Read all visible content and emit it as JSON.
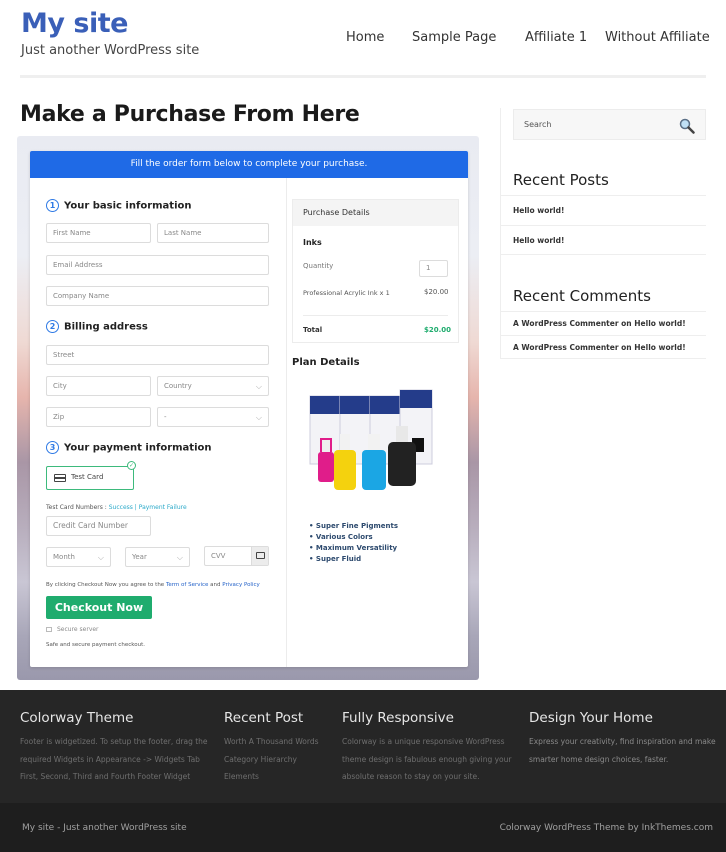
{
  "header": {
    "site_title": "My site",
    "tagline": "Just another WordPress site",
    "nav": [
      "Home",
      "Sample Page",
      "Affiliate 1",
      "Without Affiliate"
    ]
  },
  "page": {
    "title": "Make a Purchase From Here"
  },
  "form": {
    "banner": "Fill the order form below to complete your purchase.",
    "step1": {
      "num": "1",
      "title": "Your basic information"
    },
    "step2": {
      "num": "2",
      "title": "Billing address"
    },
    "step3": {
      "num": "3",
      "title": "Your payment information"
    },
    "placeholders": {
      "first_name": "First Name",
      "last_name": "Last Name",
      "email": "Email Address",
      "company": "Company Name",
      "street": "Street",
      "city": "City",
      "country": "Country",
      "zip": "Zip",
      "state": "-",
      "card_number": "Credit Card Number",
      "month": "Month",
      "year": "Year",
      "cvv": "CVV"
    },
    "payment_method": "Test Card",
    "test_numbers_label": "Test Card Numbers : ",
    "test_success": "Success",
    "test_sep": " | ",
    "test_failure": "Payment Failure",
    "agree_prefix": "By clicking Checkout Now you agree to the ",
    "terms": "Term of Service",
    "and": " and ",
    "privacy": "Privacy Policy",
    "checkout_label": "Checkout Now",
    "secure_label": "Secure server",
    "safe_label": "Safe and secure payment checkout."
  },
  "purchase": {
    "header": "Purchase Details",
    "product_group": "Inks",
    "quantity_label": "Quantity",
    "quantity_value": "1",
    "item_name": "Professional Acrylic Ink x 1",
    "item_price": "$20.00",
    "total_label": "Total",
    "total_value": "$20.00",
    "total_color": "#1fac6e"
  },
  "plan": {
    "title": "Plan Details",
    "image_alt": "ink bottles product image",
    "features": [
      "Super Fine Pigments",
      "Various Colors",
      "Maximum Versatility",
      "Super Fluid"
    ]
  },
  "sidebar": {
    "search_placeholder": "Search",
    "recent_posts_title": "Recent Posts",
    "recent_posts": [
      "Hello world!",
      "Hello world!"
    ],
    "recent_comments_title": "Recent Comments",
    "recent_comments": [
      "A WordPress Commenter on Hello world!",
      "A WordPress Commenter on Hello world!"
    ]
  },
  "footer": {
    "cols": [
      {
        "title": "Colorway Theme",
        "lines": [
          "Footer is widgetized. To setup the footer, drag the",
          "required Widgets in Appearance -> Widgets Tab",
          "First, Second, Third and Fourth Footer Widget"
        ]
      },
      {
        "title": "Recent Post",
        "lines": [
          "Worth A Thousand Words",
          "Category Hierarchy",
          "Elements"
        ]
      },
      {
        "title": "Fully Responsive",
        "lines": [
          "Colorway is a unique responsive WordPress",
          "theme design is fabulous enough giving your",
          "absolute reason to stay on your site."
        ]
      },
      {
        "title": "Design Your Home",
        "lines": [
          "Express your creativity, find inspiration and make",
          "smarter home design choices, faster."
        ]
      }
    ],
    "bottom_left": "My site - Just another WordPress site",
    "bottom_right": "Colorway WordPress Theme by InkThemes.com"
  },
  "colors": {
    "brand": "#3a5fb8",
    "banner": "#1f6ae6",
    "checkout": "#1fac6e",
    "footer": "#262626"
  }
}
